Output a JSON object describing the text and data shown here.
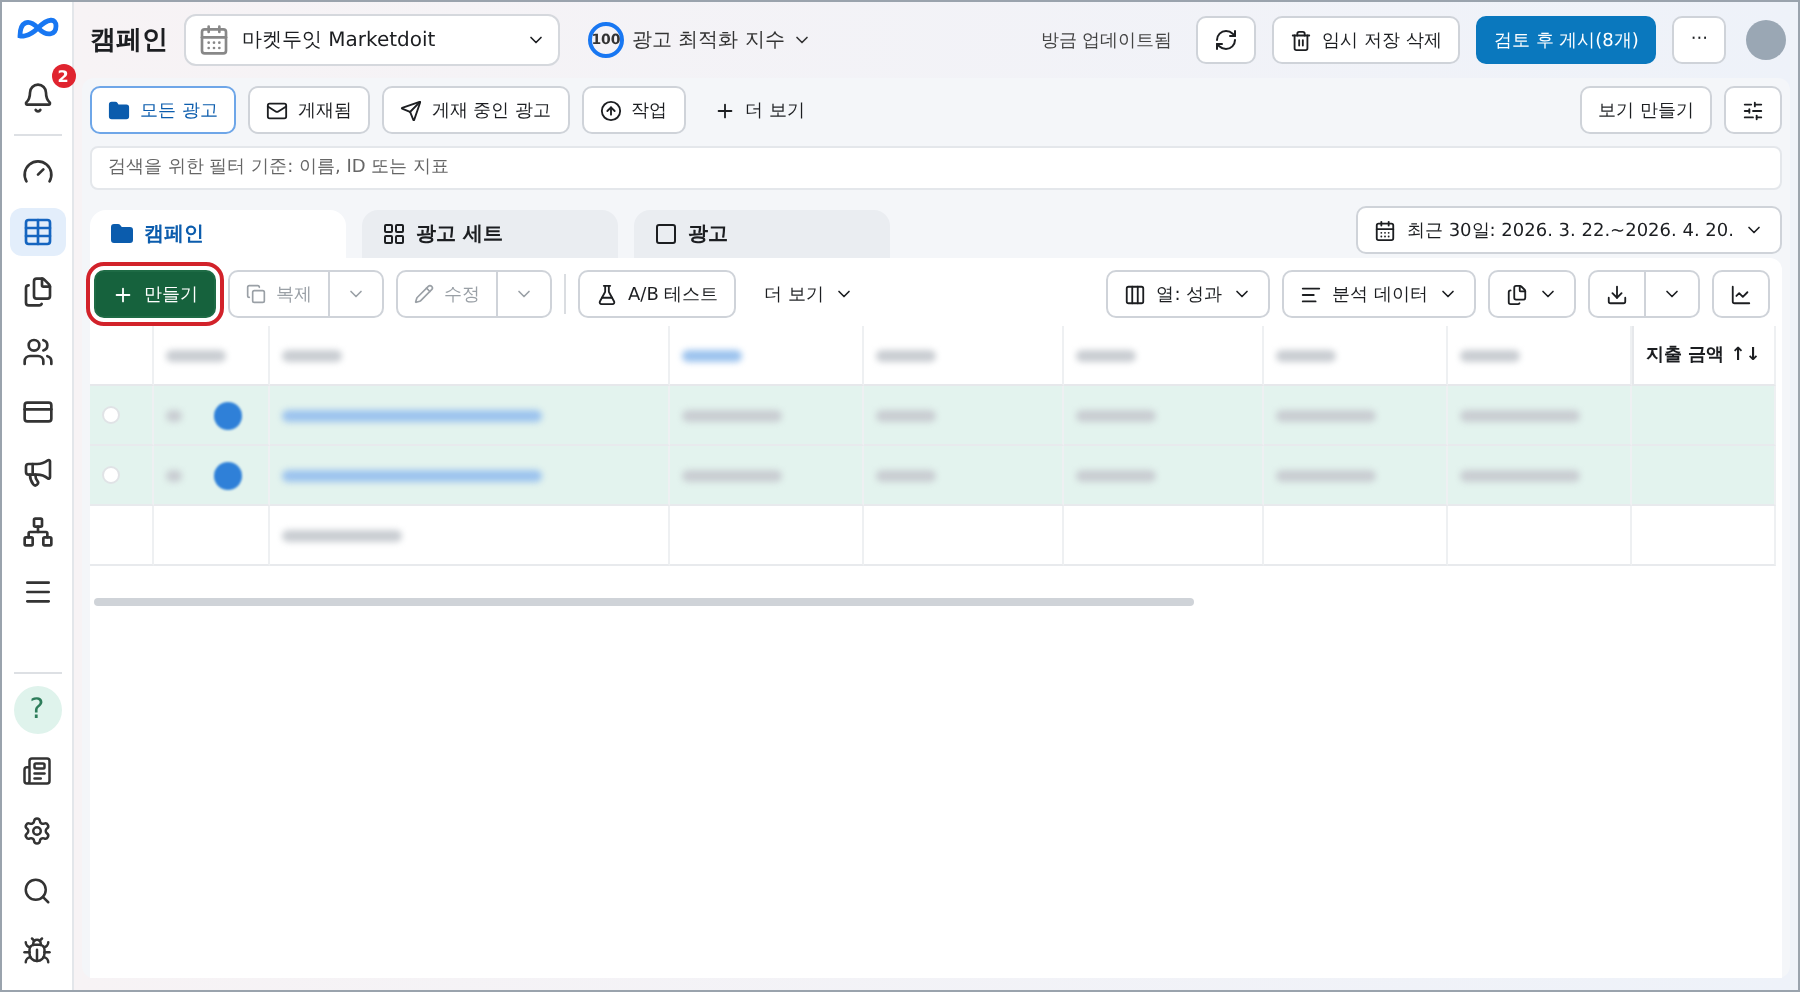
{
  "header": {
    "title": "캠페인",
    "account": "마켓두잇 Marketdoit",
    "score": "100",
    "score_label": "광고 최적화 지수",
    "updated": "방금 업데이트됨",
    "discard": "임시 저장 삭제",
    "publish": "검토 후 게시(8개)",
    "more": "···"
  },
  "sidebar": {
    "notifications": "2",
    "items": [
      {
        "selected": false
      },
      {
        "selected": true
      },
      {
        "selected": false
      },
      {
        "selected": false
      },
      {
        "selected": false
      },
      {
        "selected": false
      },
      {
        "selected": false
      },
      {
        "selected": false
      }
    ],
    "bottom": [
      {
        "kind": "help",
        "label": "?"
      },
      {
        "kind": "news"
      },
      {
        "kind": "settings"
      },
      {
        "kind": "search"
      },
      {
        "kind": "bug"
      }
    ]
  },
  "filters": [
    {
      "label": "모든 광고",
      "selected": true
    },
    {
      "label": "게재됨",
      "selected": false
    },
    {
      "label": "게재 중인 광고",
      "selected": false
    },
    {
      "label": "작업",
      "selected": false
    }
  ],
  "more_filters": "더 보기",
  "create_view": "보기 만들기",
  "search": {
    "placeholder": "검색을 위한 필터 기준: 이름, ID 또는 지표"
  },
  "tabs": [
    {
      "label": "캠페인",
      "selected": true
    },
    {
      "label": "광고 세트",
      "selected": false
    },
    {
      "label": "광고",
      "selected": false
    }
  ],
  "date_range": "최근 30일: 2026. 3. 22.~2026. 4. 20.",
  "toolbar": {
    "create": {
      "label": "만들기",
      "highlighted": true
    },
    "duplicate": {
      "label": "복제",
      "disabled": true
    },
    "edit": {
      "label": "수정",
      "disabled": true
    },
    "ab_test": "A/B 테스트",
    "more": "더 보기",
    "columns": "열: 성과",
    "breakdown": "분석 데이터"
  },
  "table": {
    "columns": [
      {
        "blurred": true
      },
      {
        "blurred": true
      },
      {
        "blurred": true
      },
      {
        "blurred": true
      },
      {
        "blurred": true
      },
      {
        "blurred": true
      },
      {
        "blurred": true
      },
      {
        "blurred": false,
        "label": "지출 금액 ↑↓"
      }
    ],
    "rows": [
      {
        "kind": "campaign",
        "selected": true
      },
      {
        "kind": "campaign",
        "selected": true
      },
      {
        "kind": "summary",
        "selected": false
      }
    ]
  }
}
